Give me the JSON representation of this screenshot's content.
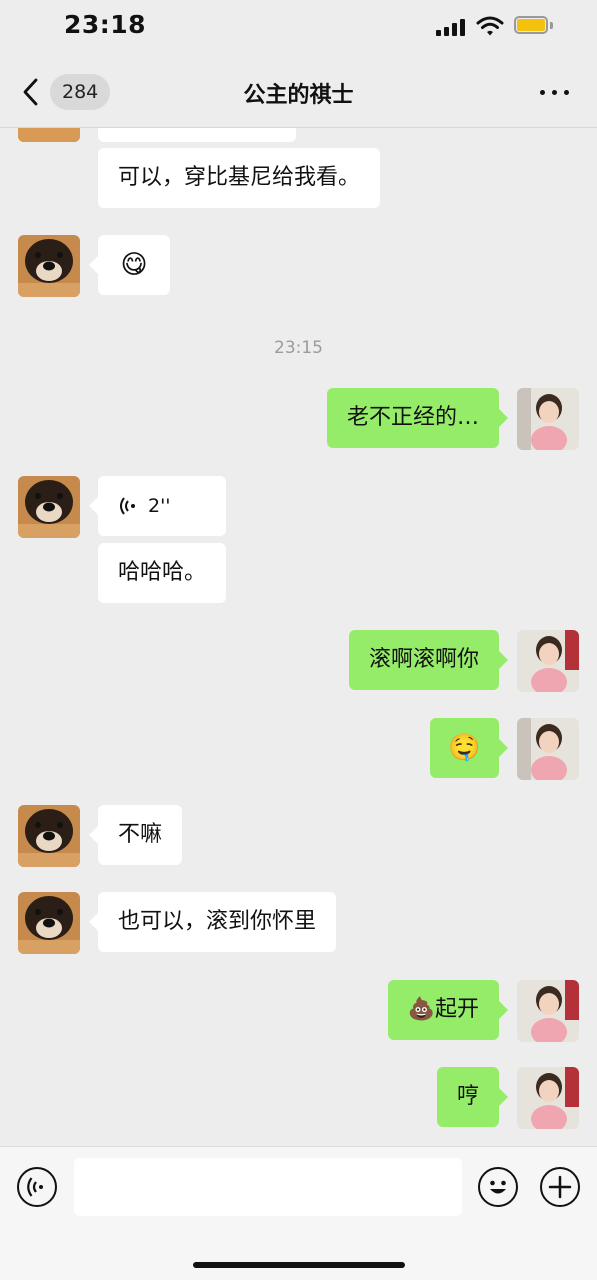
{
  "status": {
    "time": "23:18"
  },
  "nav": {
    "back_badge": "284",
    "title": "公主的祺士"
  },
  "messages": {
    "m1": "可以，穿比基尼给我看。",
    "m2_emoji": "😋",
    "time_1": "23:15",
    "m3": "老不正经的…",
    "m4_voice": "2''",
    "m5": "哈哈哈。",
    "m6": "滚啊滚啊你",
    "m7_emoji": "🤤",
    "m8": "不嘛",
    "m9": "也可以，滚到你怀里",
    "m10": "💩起开",
    "m11": "哼"
  },
  "colors": {
    "incoming_bubble": "#ffffff",
    "outgoing_bubble": "#95ec69",
    "background": "#ededed"
  },
  "icons": [
    "back-chevron-icon",
    "more-dots-icon",
    "voice-mode-icon",
    "emoji-icon",
    "plus-icon",
    "voice-wave-icon"
  ]
}
